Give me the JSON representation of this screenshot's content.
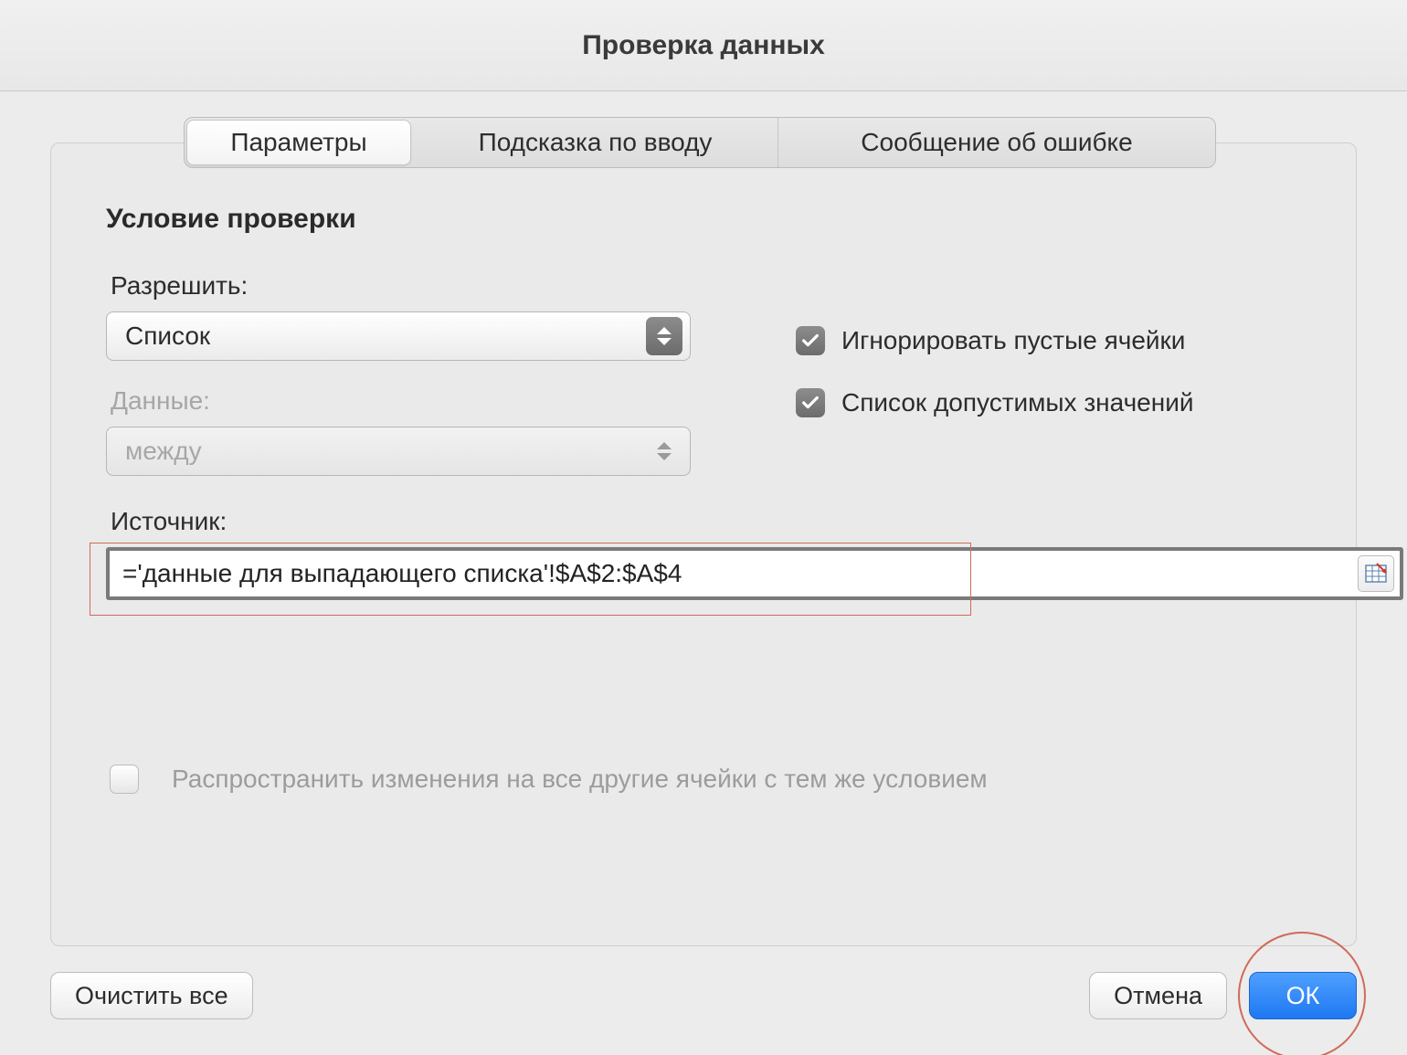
{
  "dialog": {
    "title": "Проверка данных"
  },
  "tabs": {
    "settings": "Параметры",
    "input_message": "Подсказка по вводу",
    "error_alert": "Сообщение об ошибке"
  },
  "criteria": {
    "section_title": "Условие проверки",
    "allow_label": "Разрешить:",
    "allow_value": "Список",
    "data_label": "Данные:",
    "data_value": "между",
    "source_label": "Источник:",
    "source_value": "='данные для выпадающего списка'!$A$2:$A$4"
  },
  "checks": {
    "ignore_blank": "Игнорировать пустые ячейки",
    "in_cell_dropdown": "Список допустимых значений",
    "propagate": "Распространить изменения на все другие ячейки с тем же условием"
  },
  "buttons": {
    "clear_all": "Очистить все",
    "cancel": "Отмена",
    "ok": "ОК"
  }
}
